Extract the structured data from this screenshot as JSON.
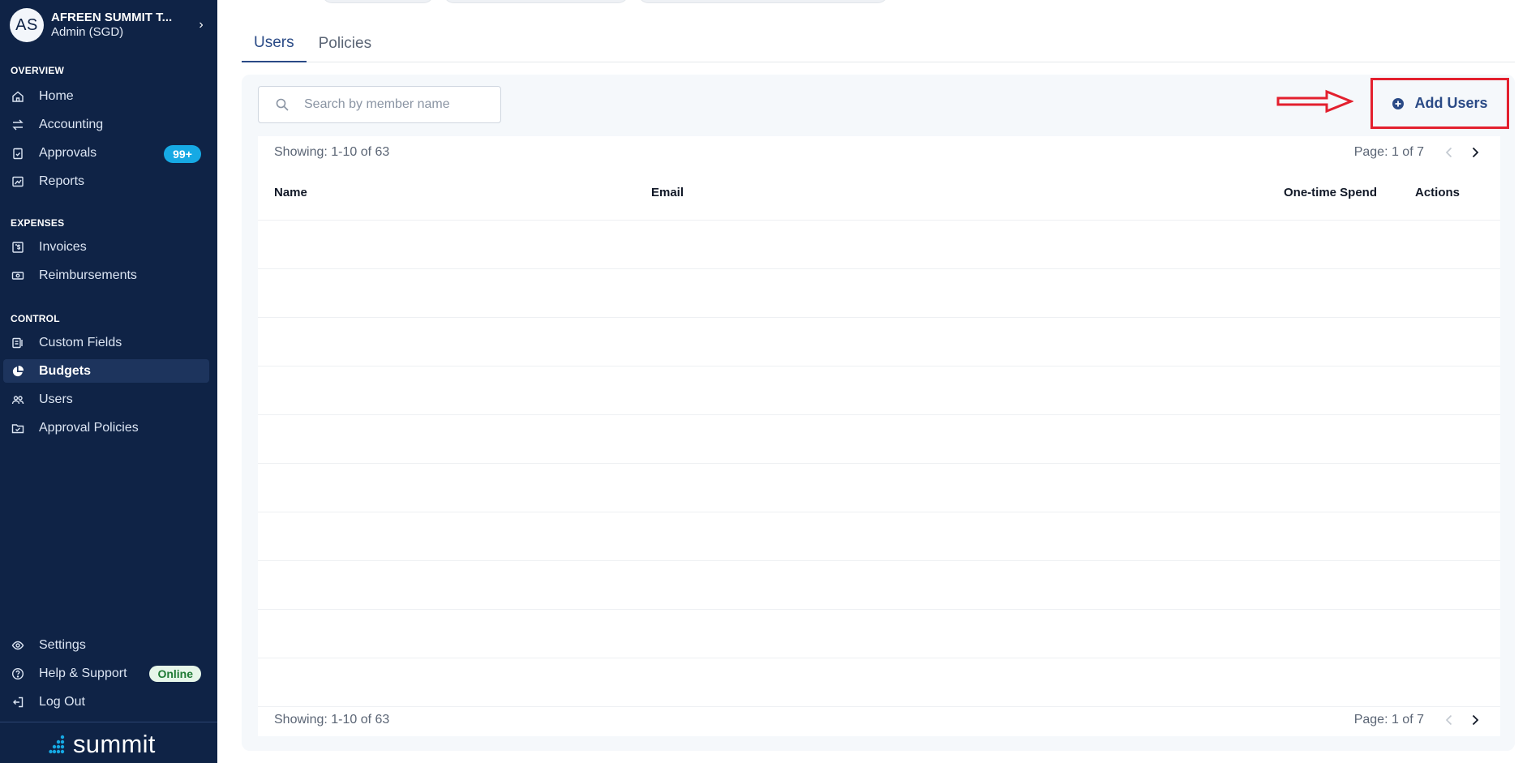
{
  "account": {
    "initials": "AS",
    "name": "AFREEN SUMMIT T...",
    "role": "Admin (SGD)"
  },
  "sidebar": {
    "overview_title": "OVERVIEW",
    "overview": [
      {
        "label": "Home",
        "icon": "home-icon"
      },
      {
        "label": "Accounting",
        "icon": "transfer-arrows-icon"
      },
      {
        "label": "Approvals",
        "icon": "clipboard-check-icon",
        "badge": "99+"
      },
      {
        "label": "Reports",
        "icon": "line-chart-icon"
      }
    ],
    "expenses_title": "EXPENSES",
    "expenses": [
      {
        "label": "Invoices",
        "icon": "invoice-dollar-icon"
      },
      {
        "label": "Reimbursements",
        "icon": "banknote-icon"
      }
    ],
    "control_title": "CONTROL",
    "control": [
      {
        "label": "Custom Fields",
        "icon": "fields-icon"
      },
      {
        "label": "Budgets",
        "icon": "pie-chart-icon",
        "active": true
      },
      {
        "label": "Users",
        "icon": "users-icon"
      },
      {
        "label": "Approval Policies",
        "icon": "policy-check-icon"
      }
    ],
    "bottom": [
      {
        "label": "Settings",
        "icon": "eye-settings-icon"
      },
      {
        "label": "Help & Support",
        "icon": "help-circle-icon",
        "badge": "Online"
      },
      {
        "label": "Log Out",
        "icon": "logout-icon"
      }
    ],
    "brand": "summit"
  },
  "tabs": [
    {
      "label": "Users",
      "active": true
    },
    {
      "label": "Policies",
      "active": false
    }
  ],
  "search": {
    "placeholder": "Search by member name",
    "value": ""
  },
  "add_users_label": "Add Users",
  "table": {
    "showing": "Showing: 1-10 of 63",
    "page": "Page: 1 of 7",
    "columns": [
      "Name",
      "Email",
      "One-time Spend",
      "Actions"
    ]
  },
  "colors": {
    "sidebar_bg": "#0f2346",
    "accent": "#2a4a86",
    "badge_blue": "#16a9e4",
    "annotation_red": "#e3202e"
  }
}
